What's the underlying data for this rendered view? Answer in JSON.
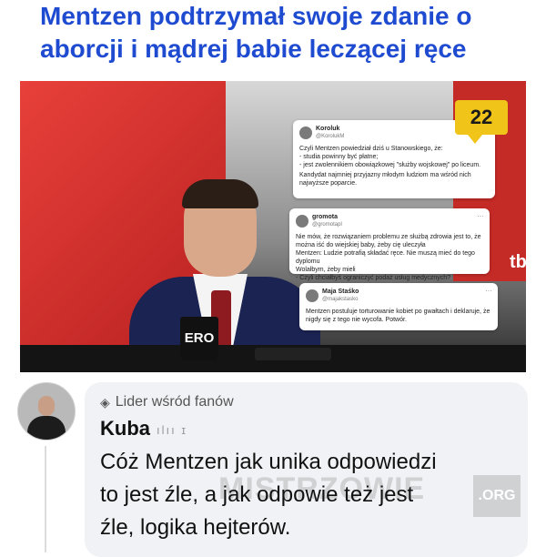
{
  "headline": "Mentzen podtrzymał swoje zdanie o aborcji i mądrej babie leczącej ręce",
  "image": {
    "badge": "22",
    "mug_text": "ERO",
    "tv_logo": "tb",
    "tweets": [
      {
        "name": "Koroluk",
        "handle": "@KorolukM",
        "paragraphs": [
          "Czyli Mentzen powiedział dziś u Stanowskiego, że:\n- studia powinny być płatne;\n- jest zwolennikiem obowiązkowej \"służby wojskowej\" po liceum.",
          "Kandydat najmniej przyjazny młodym ludziom ma wśród nich najwyższe poparcie."
        ]
      },
      {
        "name": "gromota",
        "handle": "@gromotapl",
        "paragraphs": [
          "Nie mów, że rozwiązaniem problemu ze służbą zdrowia jest to, że można iść do wiejskiej baby, żeby cię uleczyła\nMentzen: Ludzie potrafią składać ręce. Nie muszą mieć do tego dyplomu\nWolałbym, żeby mieli\n- Czyli chciałbyś ograniczyć podaż usług medycznych?"
        ]
      },
      {
        "name": "Maja Staśko",
        "handle": "@majakstasko",
        "paragraphs": [
          "Mentzen postuluje torturowanie kobiet po gwałtach i deklaruje, że nigdy się z tego nie wycofa. Potwór."
        ]
      }
    ]
  },
  "comment": {
    "fan_badge": "Lider wśród fanów",
    "author": "Kuba",
    "author_extra": "ılıı ɪ",
    "text": "Cóż Mentzen jak unika odpowiedzi\nto jest źle, a jak odpowie też jest\nźle, logika hejterów.",
    "watermark": "MISTRZOWIE",
    "watermark_suffix": ".ORG"
  }
}
